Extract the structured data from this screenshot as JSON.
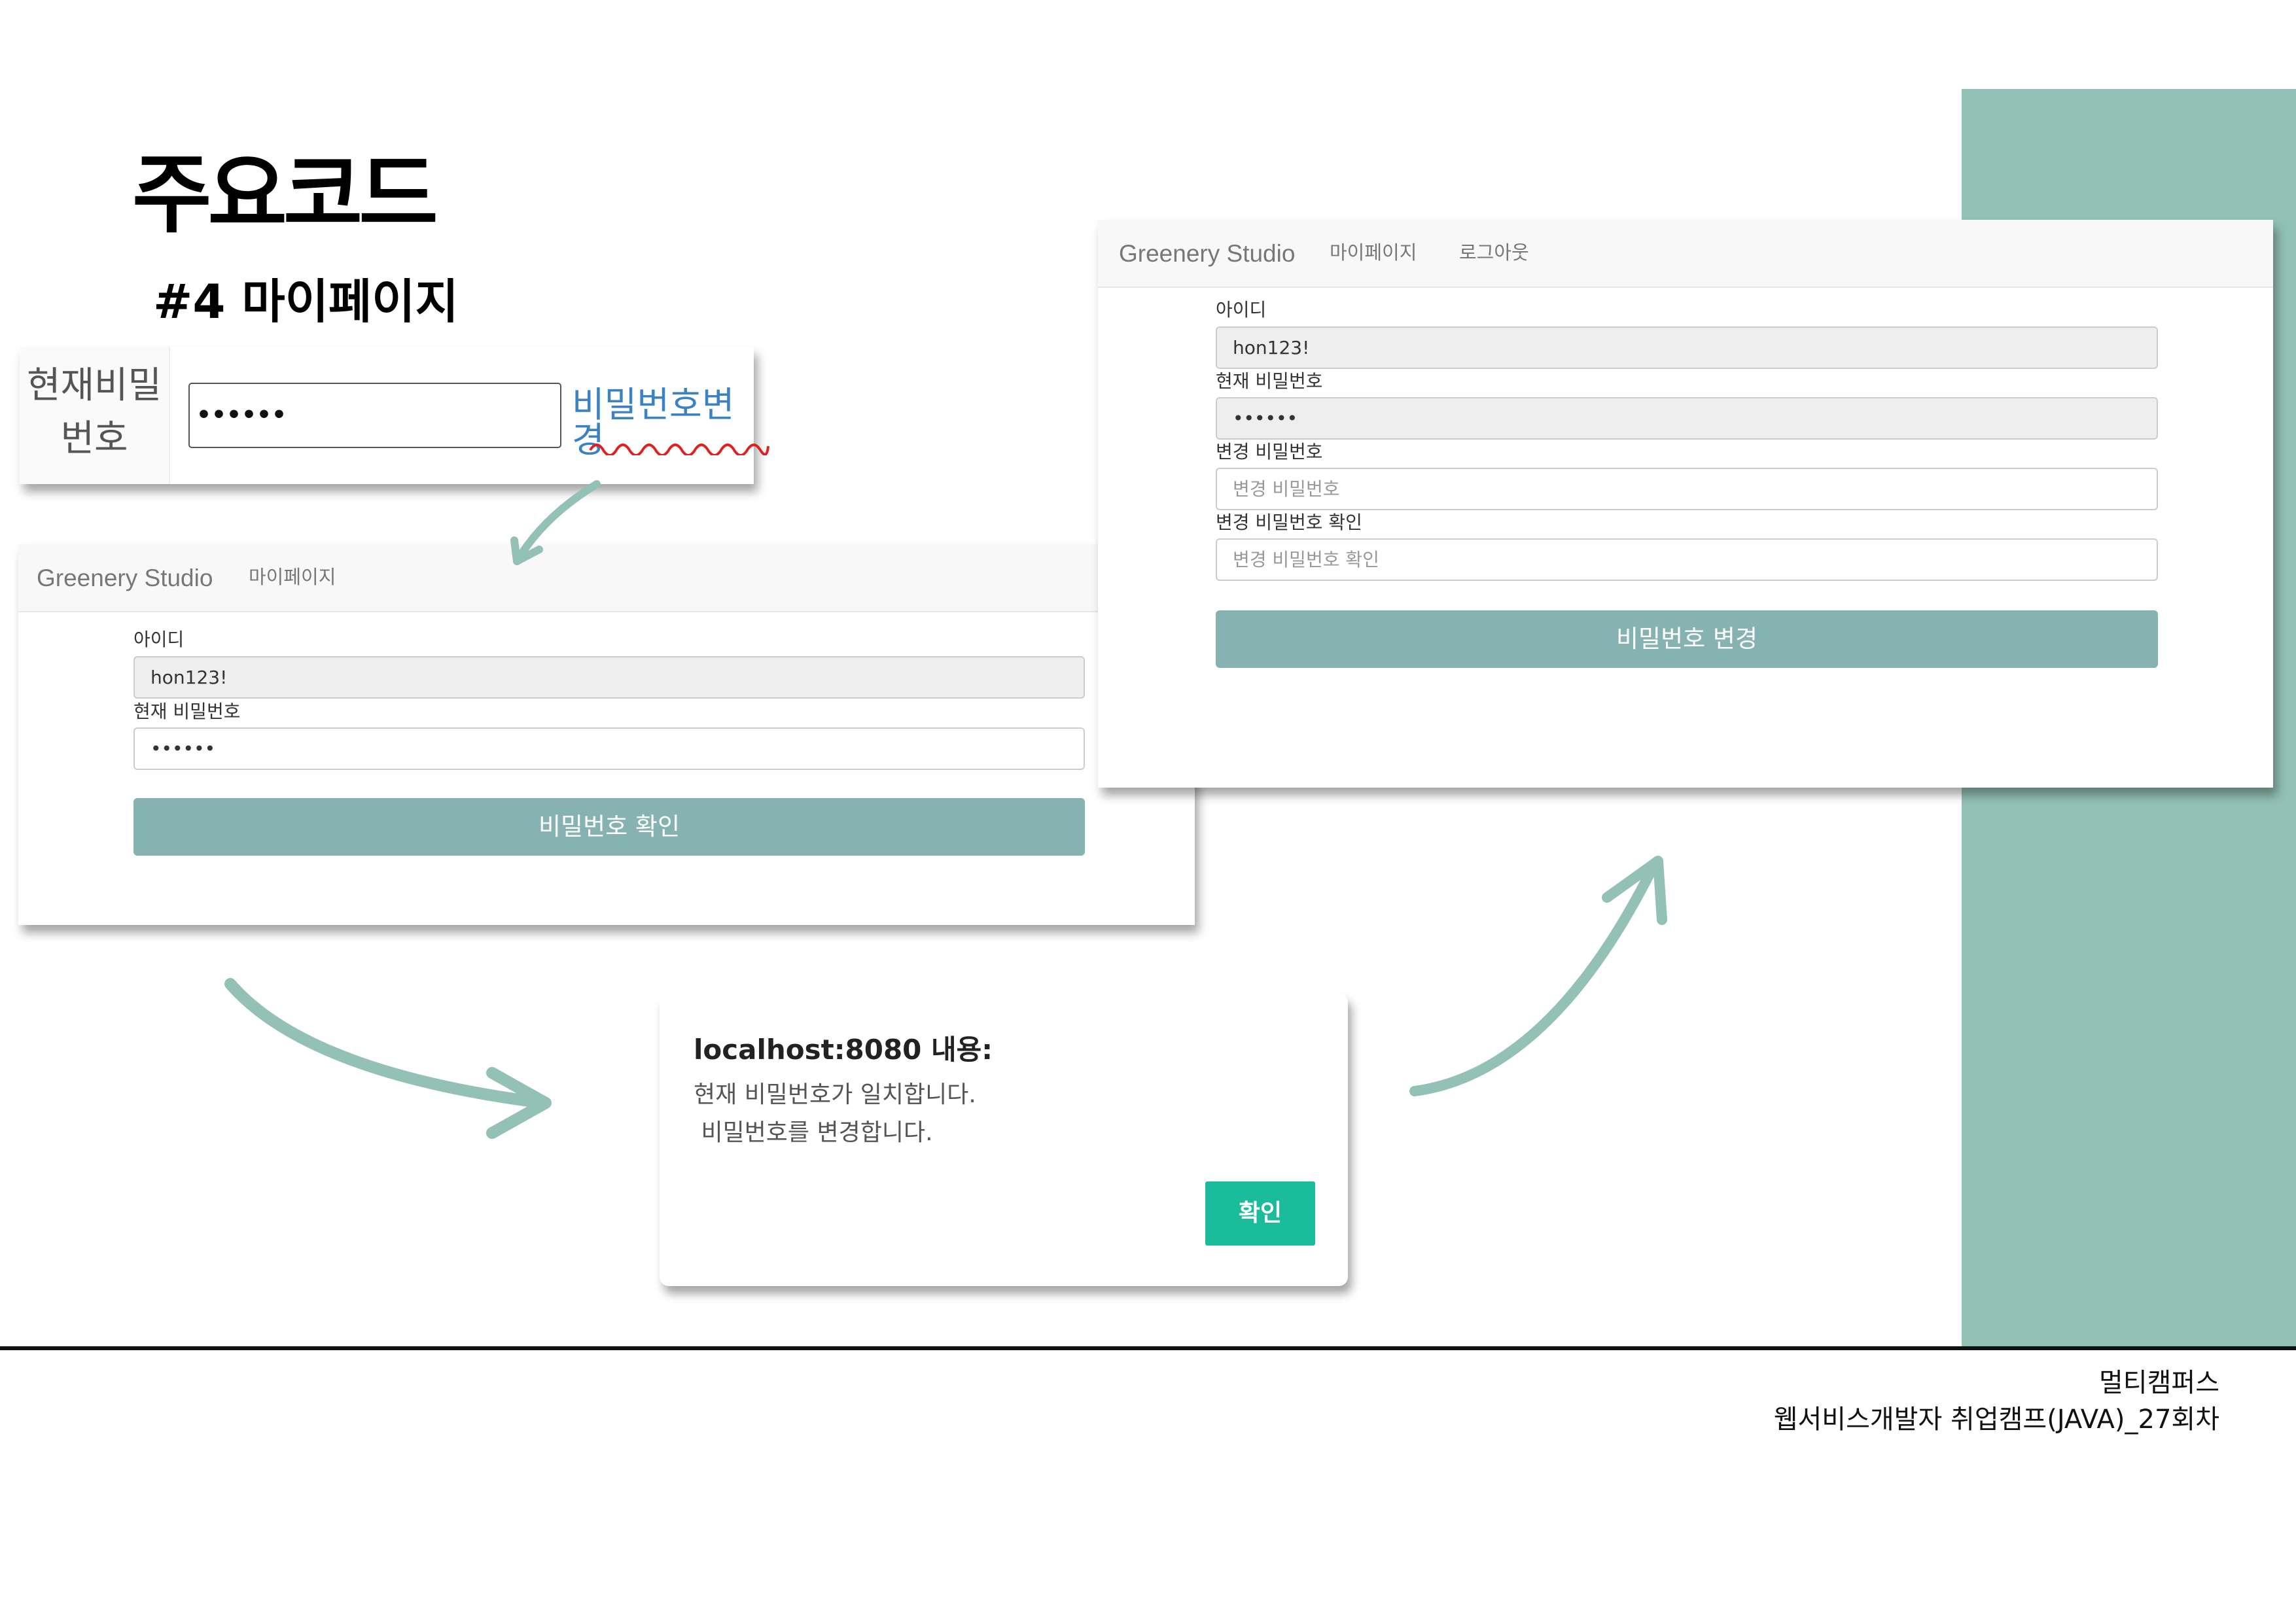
{
  "slide": {
    "title": "주요코드",
    "subtitle": "#4 마이페이지",
    "accent_color": "#93c1b5",
    "footer": {
      "line1": "멀티캠퍼스",
      "line2": "웹서비스개발자 취업캠프(JAVA)_27회차"
    }
  },
  "crop": {
    "label_line1": "현재비밀",
    "label_line2": "번호",
    "password_value": "••••••",
    "link": "비밀번호변경",
    "link_color": "#3a82c4"
  },
  "verify_form": {
    "brand": "Greenery Studio",
    "nav": [
      "마이페이지"
    ],
    "id_label": "아이디",
    "id_value": "hon123!",
    "current_pw_label": "현재 비밀번호",
    "current_pw_value": "••••••",
    "submit_label": "비밀번호 확인",
    "button_color": "#86b3b1"
  },
  "alert": {
    "title": "localhost:8080 내용:",
    "message_line1": "현재 비밀번호가 일치합니다.",
    "message_line2": " 비밀번호를 변경합니다.",
    "ok_label": "확인",
    "ok_color": "#1abc9c"
  },
  "change_form": {
    "brand": "Greenery Studio",
    "nav": [
      "마이페이지",
      "로그아웃"
    ],
    "id_label": "아이디",
    "id_value": "hon123!",
    "current_pw_label": "현재 비밀번호",
    "current_pw_value": "••••••",
    "new_pw_label": "변경 비밀번호",
    "new_pw_placeholder": "변경 비밀번호",
    "confirm_pw_label": "변경 비밀번호 확인",
    "confirm_pw_placeholder": "변경 비밀번호 확인",
    "submit_label": "비밀번호 변경",
    "button_color": "#86b3b1"
  }
}
